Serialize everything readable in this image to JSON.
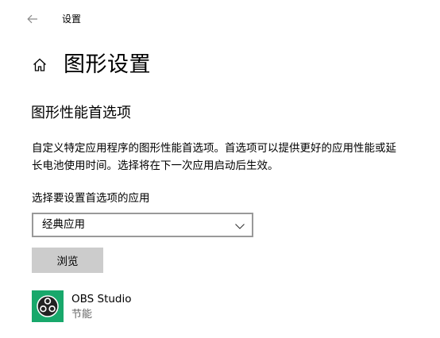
{
  "window": {
    "title": "设置",
    "back_icon": "arrow-left-icon"
  },
  "header": {
    "home_icon": "home-icon",
    "title": "图形设置"
  },
  "section": {
    "title": "图形性能首选项",
    "description": "自定义特定应用程序的图形性能首选项。首选项可以提供更好的应用性能或延长电池使用时间。选择将在下一次应用启动后生效。"
  },
  "app_select": {
    "label": "选择要设置首选项的应用",
    "value": "经典应用",
    "icon": "chevron-down-icon"
  },
  "browse_button": {
    "label": "浏览"
  },
  "apps": [
    {
      "name": "OBS Studio",
      "preference": "节能",
      "icon": "obs-logo-icon",
      "icon_bg": "#18a86b"
    }
  ],
  "colors": {
    "button_bg": "#cccccc",
    "select_border": "#999999",
    "secondary_text": "#666666"
  }
}
